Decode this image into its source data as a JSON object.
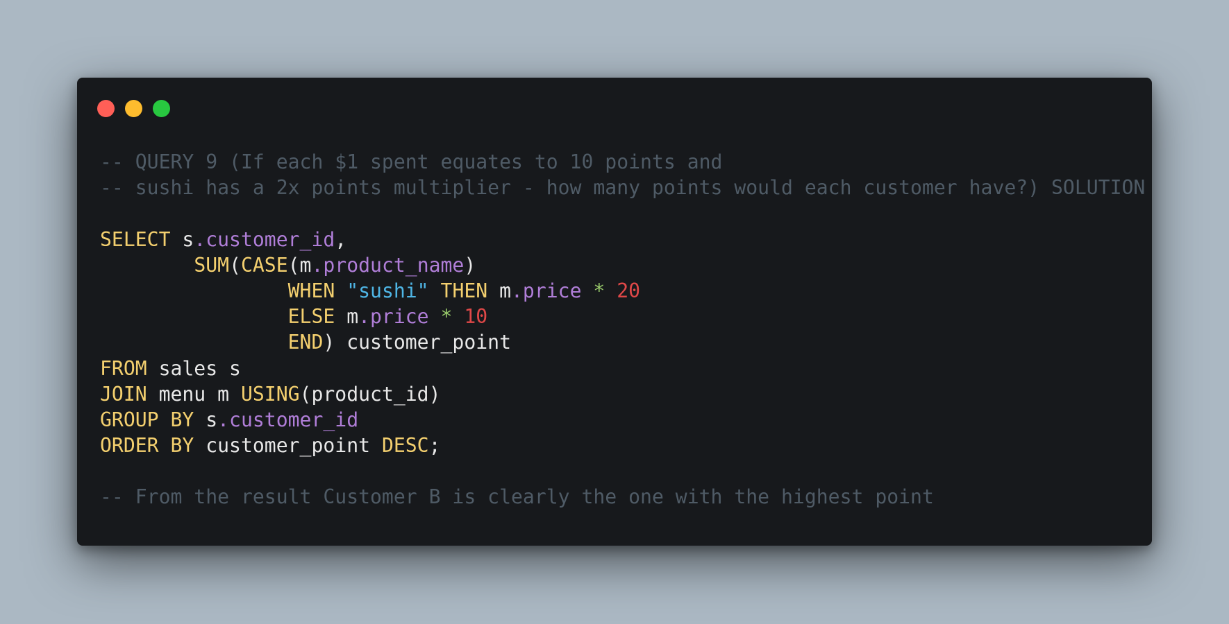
{
  "window": {
    "controls": [
      {
        "name": "close",
        "color": "#ff5f57"
      },
      {
        "name": "minimize",
        "color": "#febc2e"
      },
      {
        "name": "maximize",
        "color": "#28c840"
      }
    ]
  },
  "theme": {
    "comment": "#4f5b66",
    "keyword": "#f4d06f",
    "property": "#b07ed8",
    "string": "#4fb6e6",
    "number": "#e04848",
    "operator": "#98c96a",
    "plain": "#e8e8e8"
  },
  "code": {
    "lines": [
      [
        {
          "t": "cm",
          "v": "-- QUERY 9 (If each $1 spent equates to 10 points and"
        }
      ],
      [
        {
          "t": "cm",
          "v": "-- sushi has a 2x points multiplier - how many points would each customer have?) SOLUTION"
        }
      ],
      [],
      [
        {
          "t": "kw",
          "v": "SELECT"
        },
        {
          "t": "pl",
          "v": " s"
        },
        {
          "t": "prop",
          "v": ".customer_id"
        },
        {
          "t": "pl",
          "v": ","
        }
      ],
      [
        {
          "t": "pl",
          "v": "        "
        },
        {
          "t": "kw",
          "v": "SUM"
        },
        {
          "t": "pl",
          "v": "("
        },
        {
          "t": "kw",
          "v": "CASE"
        },
        {
          "t": "pl",
          "v": "(m"
        },
        {
          "t": "prop",
          "v": ".product_name"
        },
        {
          "t": "pl",
          "v": ")"
        }
      ],
      [
        {
          "t": "pl",
          "v": "                "
        },
        {
          "t": "kw",
          "v": "WHEN"
        },
        {
          "t": "pl",
          "v": " "
        },
        {
          "t": "str",
          "v": "\"sushi\""
        },
        {
          "t": "pl",
          "v": " "
        },
        {
          "t": "kw",
          "v": "THEN"
        },
        {
          "t": "pl",
          "v": " m"
        },
        {
          "t": "prop",
          "v": ".price"
        },
        {
          "t": "pl",
          "v": " "
        },
        {
          "t": "op",
          "v": "*"
        },
        {
          "t": "pl",
          "v": " "
        },
        {
          "t": "num",
          "v": "20"
        }
      ],
      [
        {
          "t": "pl",
          "v": "                "
        },
        {
          "t": "kw",
          "v": "ELSE"
        },
        {
          "t": "pl",
          "v": " m"
        },
        {
          "t": "prop",
          "v": ".price"
        },
        {
          "t": "pl",
          "v": " "
        },
        {
          "t": "op",
          "v": "*"
        },
        {
          "t": "pl",
          "v": " "
        },
        {
          "t": "num",
          "v": "10"
        }
      ],
      [
        {
          "t": "pl",
          "v": "                "
        },
        {
          "t": "kw",
          "v": "END"
        },
        {
          "t": "pl",
          "v": ") customer_point"
        }
      ],
      [
        {
          "t": "kw",
          "v": "FROM"
        },
        {
          "t": "pl",
          "v": " sales s"
        }
      ],
      [
        {
          "t": "kw",
          "v": "JOIN"
        },
        {
          "t": "pl",
          "v": " menu m "
        },
        {
          "t": "kw",
          "v": "USING"
        },
        {
          "t": "pl",
          "v": "(product_id)"
        }
      ],
      [
        {
          "t": "kw",
          "v": "GROUP BY"
        },
        {
          "t": "pl",
          "v": " s"
        },
        {
          "t": "prop",
          "v": ".customer_id"
        }
      ],
      [
        {
          "t": "kw",
          "v": "ORDER BY"
        },
        {
          "t": "pl",
          "v": " customer_point "
        },
        {
          "t": "kw",
          "v": "DESC"
        },
        {
          "t": "pl",
          "v": ";"
        }
      ],
      [],
      [
        {
          "t": "cm",
          "v": "-- From the result Customer B is clearly the one with the highest point"
        }
      ]
    ]
  }
}
